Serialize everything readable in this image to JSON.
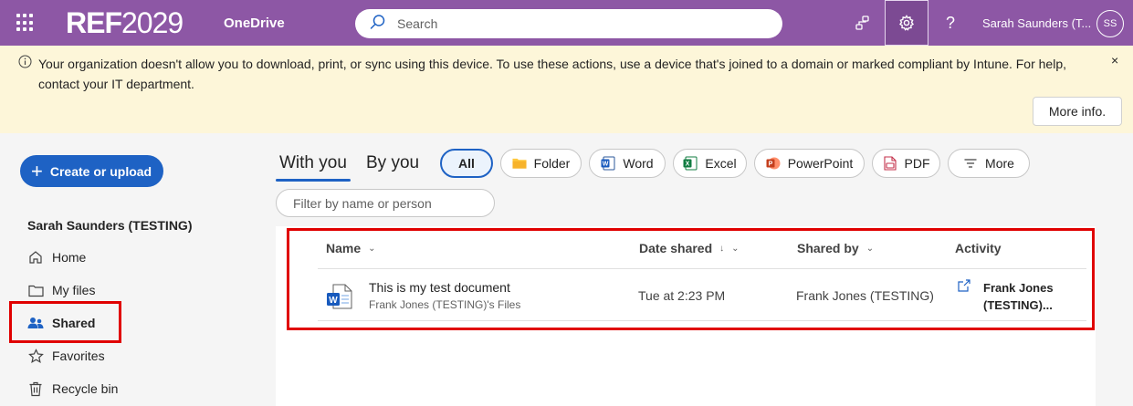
{
  "topbar": {
    "brand_bold": "REF",
    "brand_light": "2029",
    "app_name": "OneDrive",
    "search_placeholder": "Search",
    "account_name": "Sarah Saunders (T...",
    "avatar_initials": "SS",
    "help_glyph": "?"
  },
  "banner": {
    "message": "Your organization doesn't allow you to download, print, or sync using this device. To use these actions, use a device that's joined to a domain or marked compliant by Intune. For help, contact your IT department.",
    "close_glyph": "×",
    "more_info_label": "More info."
  },
  "sidebar": {
    "create_label": "Create or upload",
    "user_heading": "Sarah Saunders (TESTING)",
    "items": [
      {
        "label": "Home",
        "icon": "home-icon"
      },
      {
        "label": "My files",
        "icon": "folder-icon"
      },
      {
        "label": "Shared",
        "icon": "people-icon",
        "active": true
      },
      {
        "label": "Favorites",
        "icon": "star-icon"
      },
      {
        "label": "Recycle bin",
        "icon": "trash-icon"
      }
    ]
  },
  "tabs": {
    "with_you": "With you",
    "by_you": "By you"
  },
  "filters": {
    "chips": [
      {
        "label": "All",
        "icon": "",
        "active": true
      },
      {
        "label": "Folder",
        "icon": "folder-icon"
      },
      {
        "label": "Word",
        "icon": "word-icon"
      },
      {
        "label": "Excel",
        "icon": "excel-icon"
      },
      {
        "label": "PowerPoint",
        "icon": "powerpoint-icon"
      },
      {
        "label": "PDF",
        "icon": "pdf-icon"
      },
      {
        "label": "More",
        "icon": "filter-icon"
      }
    ],
    "name_filter_placeholder": "Filter by name or person"
  },
  "table": {
    "columns": {
      "name": "Name",
      "date_shared": "Date shared",
      "shared_by": "Shared by",
      "activity": "Activity"
    },
    "rows": [
      {
        "name": "This is my test document",
        "location": "Frank Jones (TESTING)'s Files",
        "date_shared": "Tue at 2:23 PM",
        "shared_by": "Frank Jones (TESTING)",
        "activity": "Frank Jones (TESTING)...",
        "file_icon": "word-document-icon",
        "activity_icon": "share-icon"
      }
    ]
  },
  "colors": {
    "topbar": "#8d57a5",
    "banner": "#fdf6d9",
    "accent": "#1e62c4",
    "highlight": "#e00000"
  }
}
